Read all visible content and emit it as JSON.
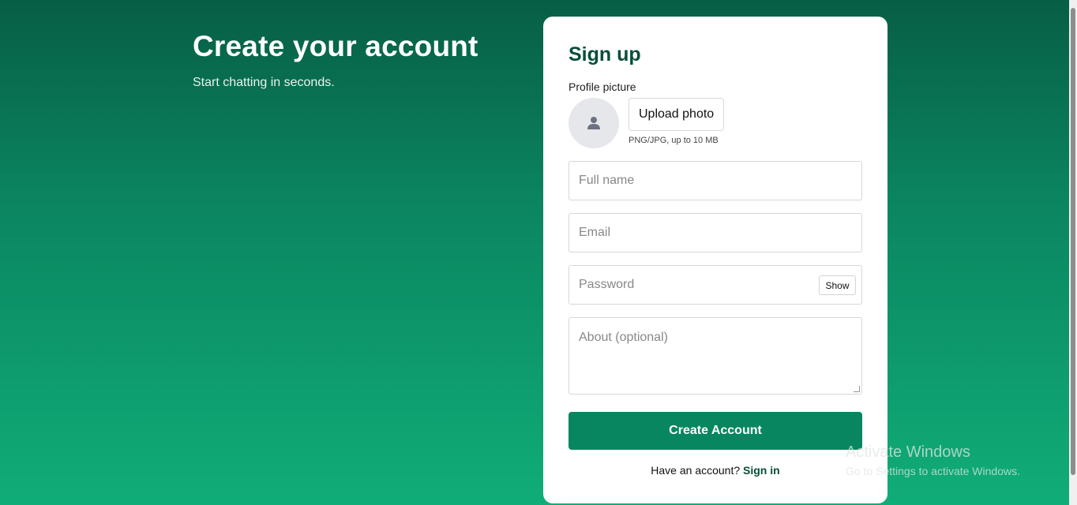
{
  "hero": {
    "title": "Create your account",
    "subtitle": "Start chatting in seconds."
  },
  "signup": {
    "title": "Sign up",
    "profile_label": "Profile picture",
    "upload_label": "Upload photo",
    "upload_hint": "PNG/JPG, up to 10 MB",
    "fields": {
      "full_name": {
        "placeholder": "Full name",
        "value": ""
      },
      "email": {
        "placeholder": "Email",
        "value": ""
      },
      "password": {
        "placeholder": "Password",
        "value": "",
        "toggle_label": "Show"
      },
      "about": {
        "placeholder": "About (optional)",
        "value": ""
      }
    },
    "submit_label": "Create Account",
    "footer_text": "Have an account?",
    "footer_link": "Sign in"
  },
  "watermark": {
    "line1": "Activate Windows",
    "line2": "Go to Settings to activate Windows."
  },
  "colors": {
    "accent": "#07865f",
    "heading": "#064e3b",
    "gradient_top": "#075e45",
    "gradient_bottom": "#10ad78"
  },
  "icons": {
    "avatar": "user-placeholder-icon"
  }
}
